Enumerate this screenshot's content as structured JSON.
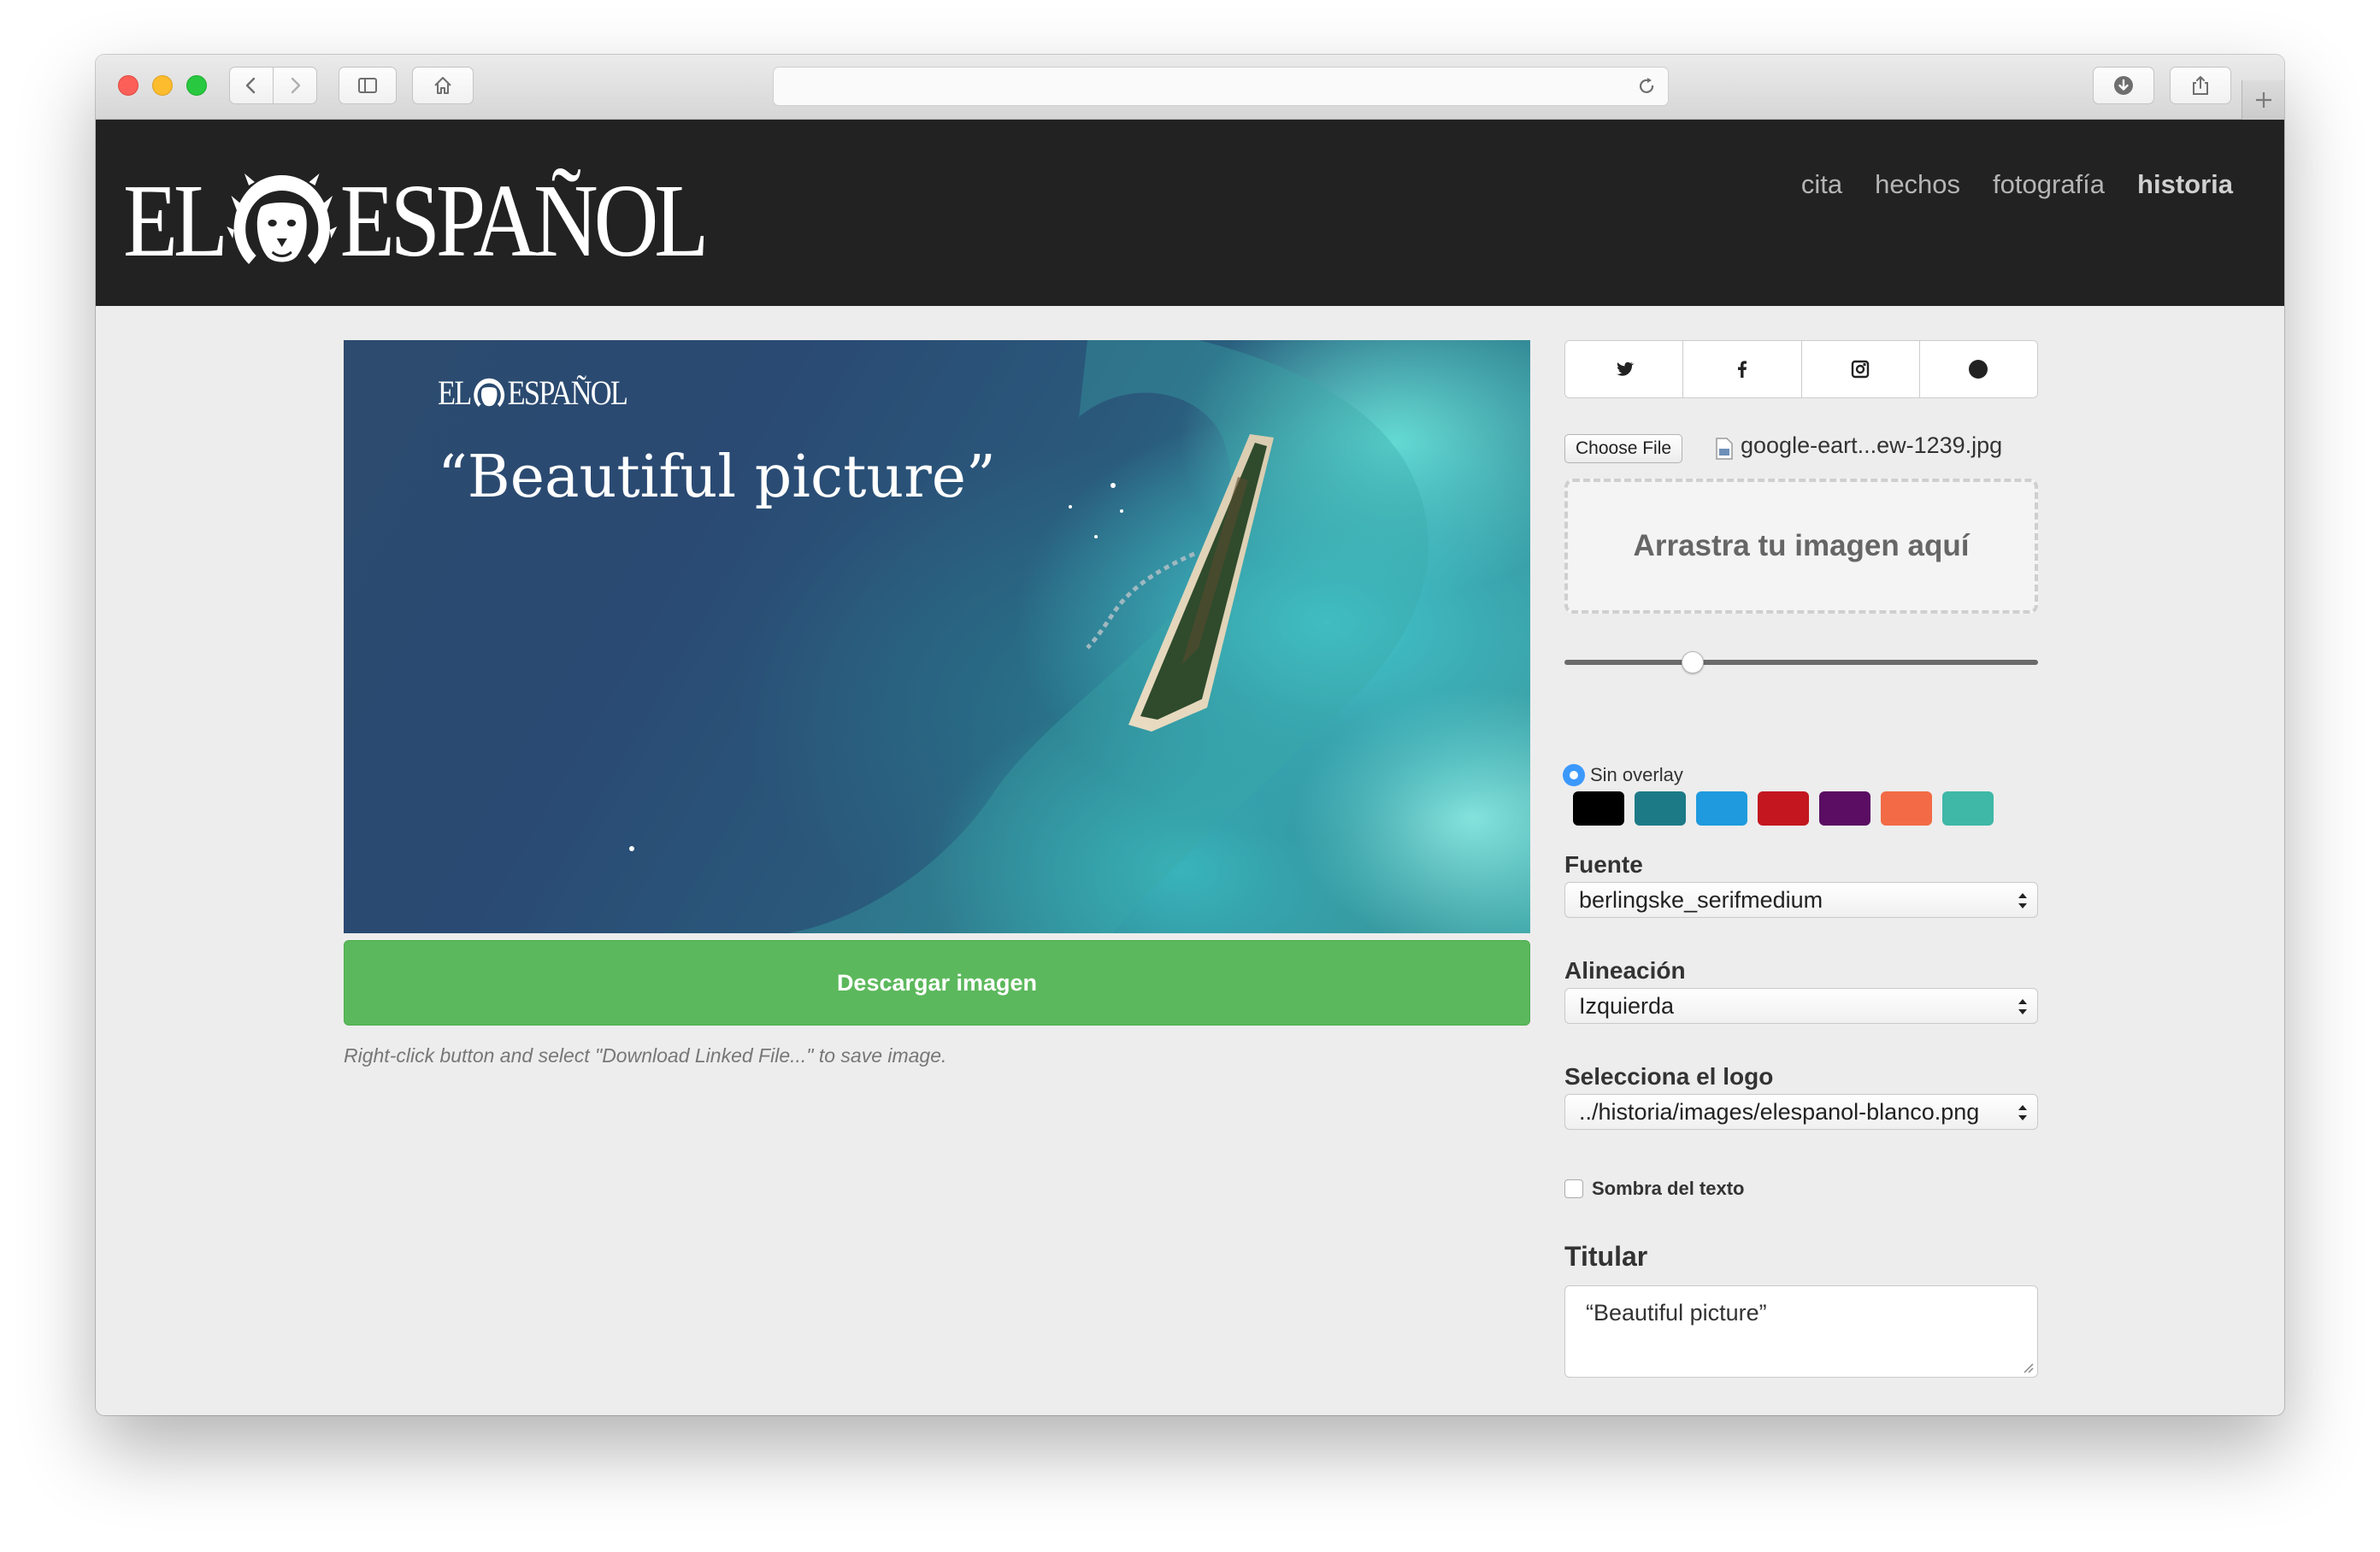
{
  "browser": {
    "url": ""
  },
  "site": {
    "logo_left": "EL",
    "logo_right": "ESPAÑOL",
    "nav": [
      {
        "label": "cita"
      },
      {
        "label": "hechos"
      },
      {
        "label": "fotografía"
      },
      {
        "label": "historia",
        "active": true
      }
    ]
  },
  "preview": {
    "logo_left": "EL",
    "logo_right": "ESPAÑOL",
    "headline": "“Beautiful picture”",
    "download_label": "Descargar imagen",
    "hint": "Right-click button and select \"Download Linked File...\" to save image."
  },
  "panel": {
    "social_icons": [
      "twitter-icon",
      "facebook-icon",
      "instagram-icon",
      "circle-icon"
    ],
    "choose_file_label": "Choose File",
    "file_name": "google-eart...ew-1239.jpg",
    "dropzone_label": "Arrastra tu imagen aquí",
    "zoom_level": 0.27,
    "overlay_label": "Sin overlay",
    "overlay_colors": [
      "#000000",
      "#1c7a86",
      "#1f9ade",
      "#c3161e",
      "#5a0d63",
      "#f26b46",
      "#3fb8a7"
    ],
    "font_label": "Fuente",
    "font_value": "berlingske_serifmedium",
    "align_label": "Alineación",
    "align_value": "Izquierda",
    "logo_select_label": "Selecciona el logo",
    "logo_select_value": "../historia/images/elespanol-blanco.png",
    "shadow_label": "Sombra del texto",
    "shadow_checked": false,
    "headline_label": "Titular",
    "headline_value": "“Beautiful picture”",
    "size_value": "60"
  },
  "colors": {
    "header_bg": "#222222",
    "download_green": "#5cb85c",
    "radio_blue": "#3b99fc"
  }
}
